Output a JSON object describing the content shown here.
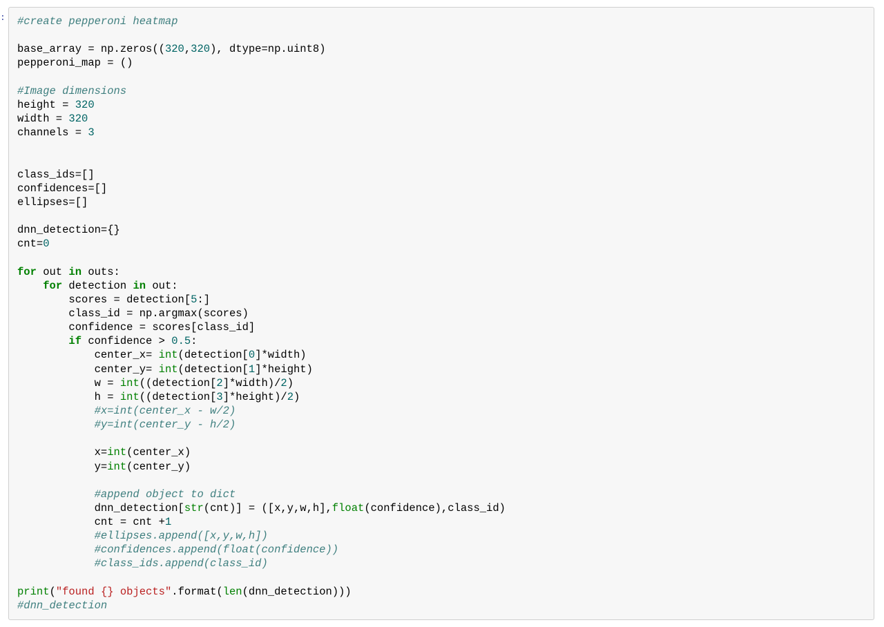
{
  "prompt_label": ":",
  "code": {
    "c_create_heatmap": "#create pepperoni heatmap",
    "l_base_array_1": "base_array = np.zeros((",
    "n_320a": "320",
    "l_base_array_2": ",",
    "n_320b": "320",
    "l_base_array_3": "), dtype=np.uint8)",
    "l_pep_map": "pepperoni_map = ()",
    "c_img_dim": "#Image dimensions",
    "l_height": "height = ",
    "n_height": "320",
    "l_width": "width = ",
    "n_width": "320",
    "l_channels": "channels = ",
    "n_channels": "3",
    "l_class_ids": "class_ids=[]",
    "l_confidences": "confidences=[]",
    "l_ellipses": "ellipses=[]",
    "l_dnn_det": "dnn_detection={}",
    "l_cnt0_a": "cnt=",
    "n_cnt0": "0",
    "k_for1": "for",
    "l_for1_mid": " out ",
    "k_in1": "in",
    "l_for1_end": " outs:",
    "k_for2": "for",
    "l_for2_mid": " detection ",
    "k_in2": "in",
    "l_for2_end": " out:",
    "l_scores_a": "scores = detection[",
    "n_5": "5",
    "l_scores_b": ":]",
    "l_classid": "class_id = np.argmax(scores)",
    "l_conf": "confidence = scores[class_id]",
    "k_if": "if",
    "l_if_mid": " confidence > ",
    "n_05": "0.5",
    "l_if_end": ":",
    "l_cx_a": "center_x= ",
    "nb_int1": "int",
    "l_cx_b": "(detection[",
    "n_0": "0",
    "l_cx_c": "]*width)",
    "l_cy_a": "center_y= ",
    "nb_int2": "int",
    "l_cy_b": "(detection[",
    "n_1": "1",
    "l_cy_c": "]*height)",
    "l_w_a": "w = ",
    "nb_int3": "int",
    "l_w_b": "((detection[",
    "n_2": "2",
    "l_w_c": "]*width)/",
    "n_2b": "2",
    "l_w_d": ")",
    "l_h_a": "h = ",
    "nb_int4": "int",
    "l_h_b": "((detection[",
    "n_3": "3",
    "l_h_c": "]*height)/",
    "n_2c": "2",
    "l_h_d": ")",
    "c_xcomm": "#x=int(center_x - w/2)",
    "c_ycomm": "#y=int(center_y - h/2)",
    "l_x_a": "x=",
    "nb_int5": "int",
    "l_x_b": "(center_x)",
    "l_y_a": "y=",
    "nb_int6": "int",
    "l_y_b": "(center_y)",
    "c_append": "#append object to dict",
    "l_dd_a": "dnn_detection[",
    "nb_str": "str",
    "l_dd_b": "(cnt)] = ([x,y,w,h],",
    "nb_float": "float",
    "l_dd_c": "(confidence),class_id)",
    "l_cnt_inc_a": "cnt = cnt +",
    "n_1b": "1",
    "c_ell": "#ellipses.append([x,y,w,h])",
    "c_conf": "#confidences.append(float(confidence))",
    "c_cls": "#class_ids.append(class_id)",
    "nb_print": "print",
    "l_print_a": "(",
    "s_found": "\"found {} objects\"",
    "l_print_b": ".format(",
    "nb_len": "len",
    "l_print_c": "(dnn_detection)))",
    "c_dnn": "#dnn_detection"
  }
}
